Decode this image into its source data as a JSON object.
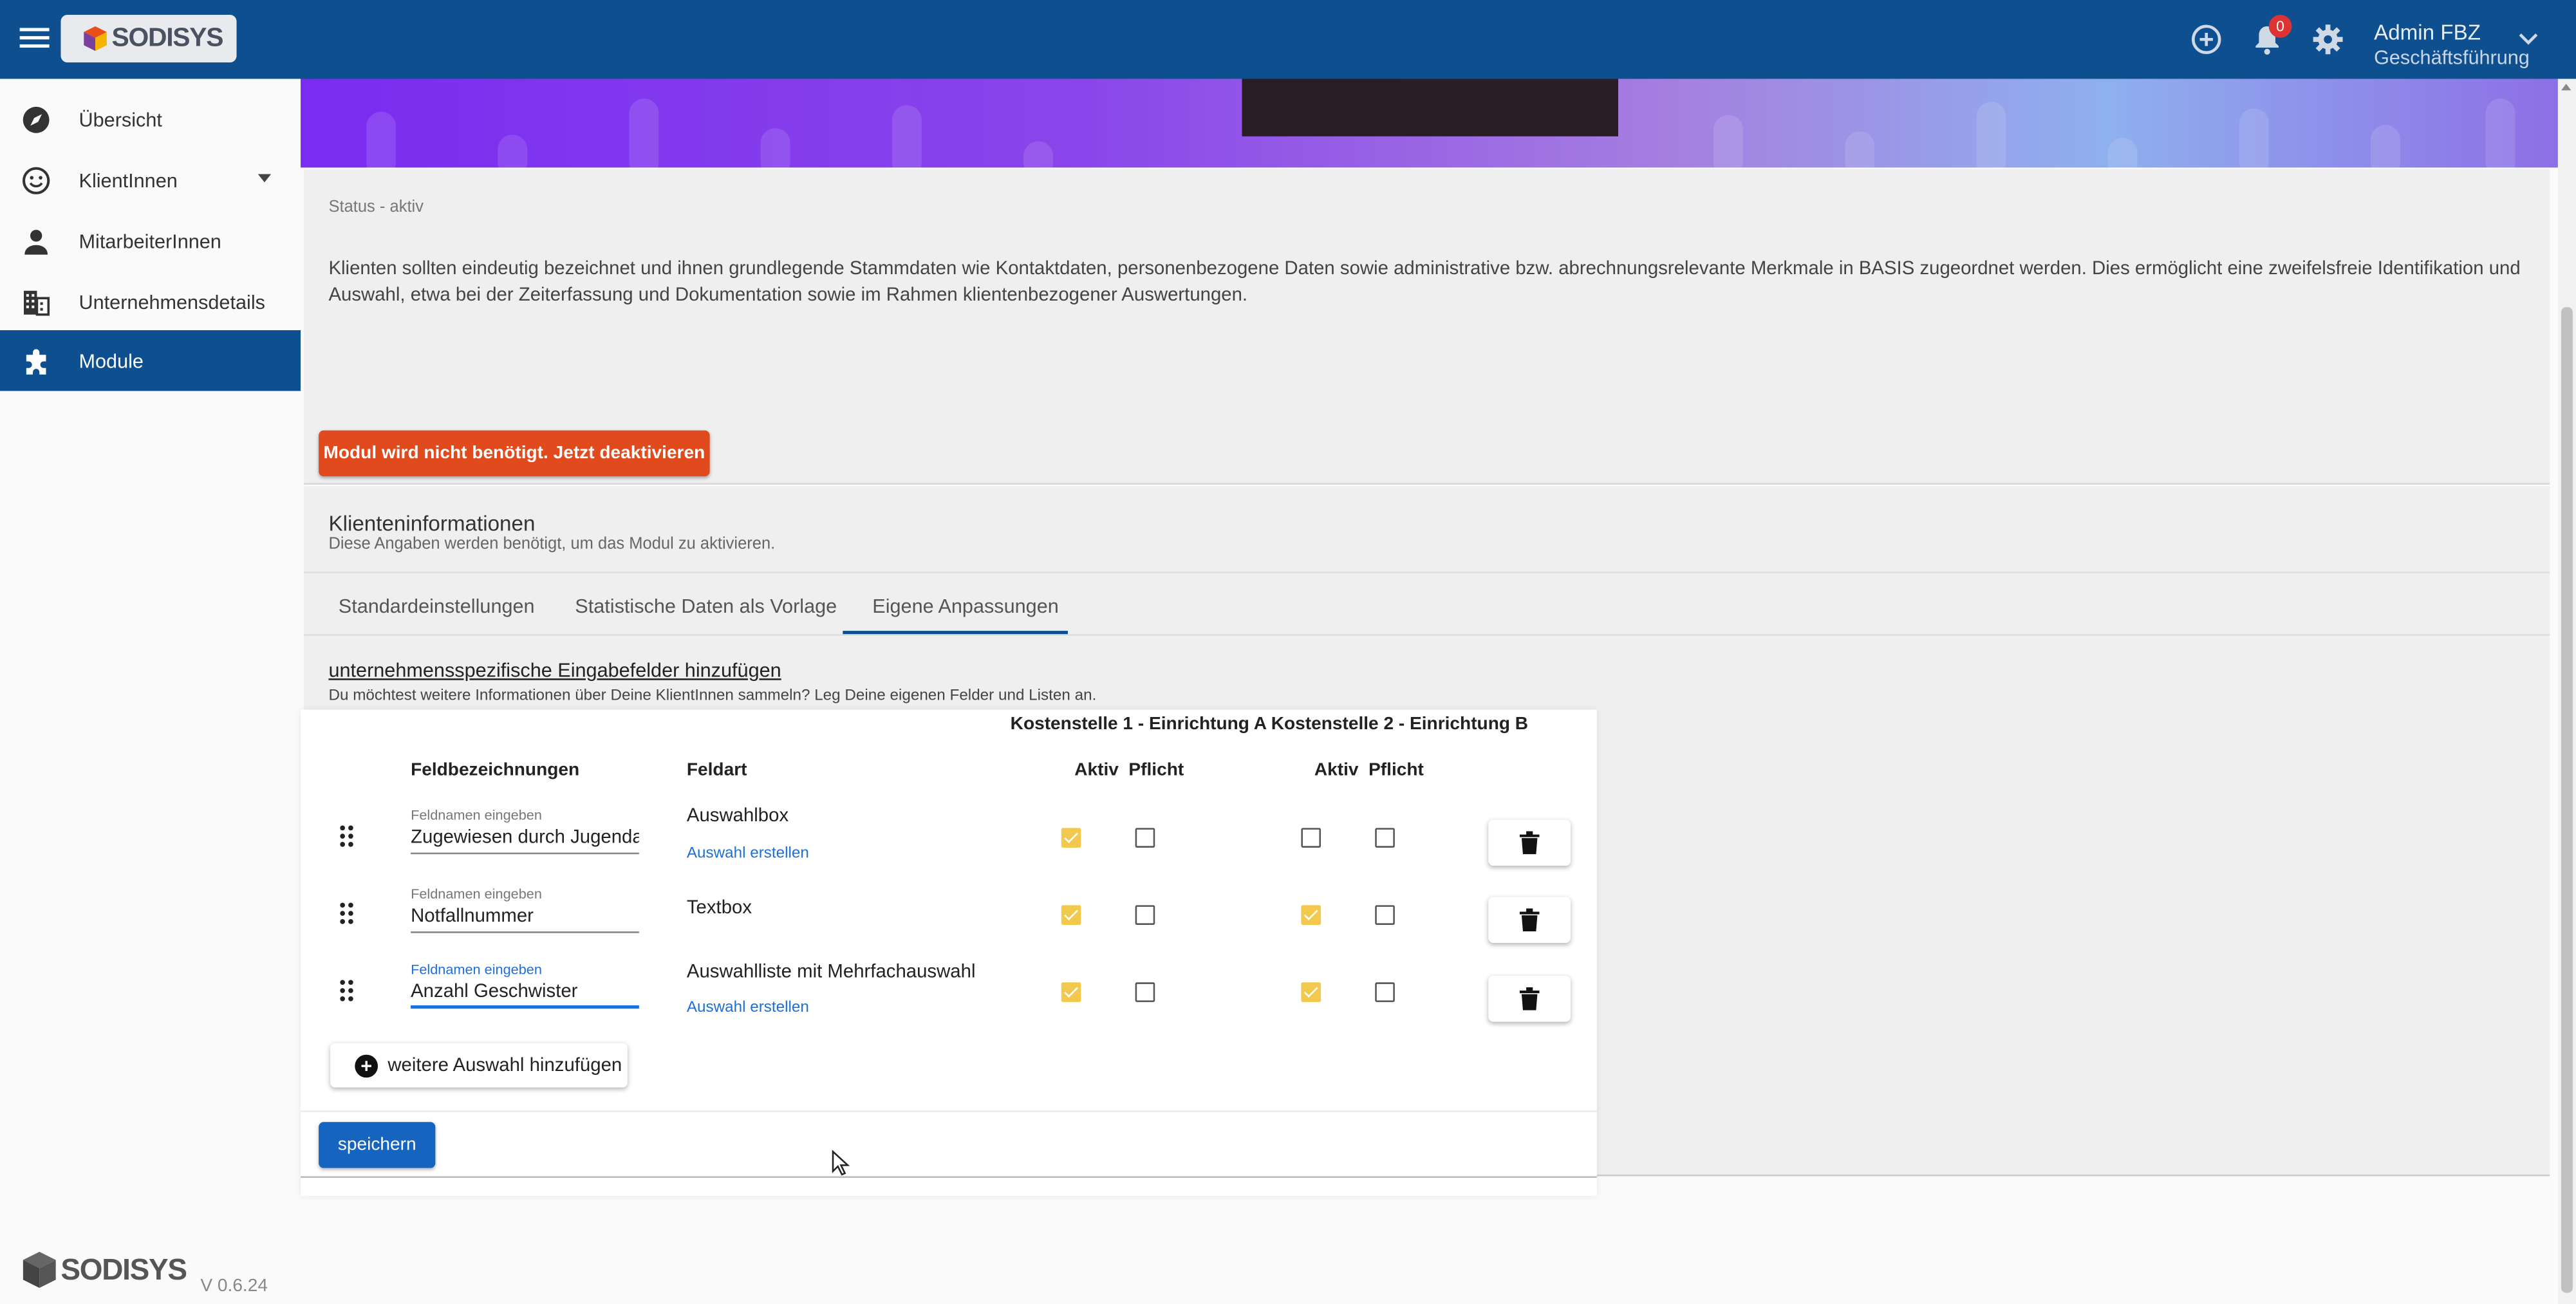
{
  "header": {
    "logo_text": "SODISYS",
    "notification_count": "0",
    "user_name": "Admin FBZ",
    "user_role": "Geschäftsführung",
    "icons": [
      "menu-icon",
      "add-circle-icon",
      "bell-icon",
      "gear-icon",
      "chevron-down-icon"
    ],
    "bar_color": "#0d4f8f"
  },
  "sidebar": {
    "items": [
      {
        "label": "Übersicht",
        "icon": "compass-icon",
        "active": false
      },
      {
        "label": "KlientInnen",
        "icon": "smiley-icon",
        "active": false,
        "expandable": true
      },
      {
        "label": "MitarbeiterInnen",
        "icon": "person-icon",
        "active": false
      },
      {
        "label": "Unternehmensdetails",
        "icon": "building-icon",
        "active": false
      },
      {
        "label": "Module",
        "icon": "puzzle-icon",
        "active": true
      }
    ],
    "footer_logo": "SODISYS",
    "version": "V 0.6.24"
  },
  "module": {
    "status": "Status - aktiv",
    "description": "Klienten sollten eindeutig bezeichnet und ihnen grundlegende Stammdaten wie Kontaktdaten, personenbezogene Daten sowie administrative bzw. abrechnungsrelevante Merkmale in BASIS zugeordnet werden. Dies ermöglicht eine zweifelsfreie Identifikation und Auswahl, etwa bei der Zeiterfassung und Dokumentation sowie im Rahmen klientenbezogener Auswertungen.",
    "deactivate_label": "Modul wird nicht benötigt. Jetzt deaktivieren",
    "deactivate_color": "#e04a1c"
  },
  "info": {
    "title": "Klienteninformationen",
    "subtitle": "Diese Angaben werden benötigt, um das Modul zu aktivieren.",
    "tabs": [
      {
        "label": "Standardeinstellungen",
        "active": false
      },
      {
        "label": "Statistische Daten als Vorlage",
        "active": false
      },
      {
        "label": "Eigene Anpassungen",
        "active": true
      }
    ],
    "custom_link": "unternehmensspezifische Eingabefelder hinzufügen",
    "custom_sub": "Du möchtest weitere Informationen über Deine KlientInnen sammeln? Leg Deine eigenen Felder und Listen an."
  },
  "dialog": {
    "cost_header": "Kostenstelle 1 - Einrichtung A Kostenstelle 2 - Einrichtung B",
    "columns": {
      "name": "Feldbezeichnungen",
      "type": "Feldart",
      "aktiv1": "Aktiv",
      "pflicht1": "Pflicht",
      "aktiv2": "Aktiv",
      "pflicht2": "Pflicht"
    },
    "rows": [
      {
        "label": "Feldnamen eingeben",
        "value": "Zugewiesen durch Jugendamt",
        "type": "Auswahlbox",
        "link": "Auswahl erstellen",
        "k1_aktiv": true,
        "k1_pflicht": false,
        "k2_aktiv": false,
        "k2_pflicht": false,
        "focused": false
      },
      {
        "label": "Feldnamen eingeben",
        "value": "Notfallnummer",
        "type": "Textbox",
        "link": "",
        "k1_aktiv": true,
        "k1_pflicht": false,
        "k2_aktiv": true,
        "k2_pflicht": false,
        "focused": false
      },
      {
        "label": "Feldnamen eingeben",
        "value": "Anzahl Geschwister",
        "type": "Auswahlliste mit Mehrfachauswahl",
        "link": "Auswahl erstellen",
        "k1_aktiv": true,
        "k1_pflicht": false,
        "k2_aktiv": true,
        "k2_pflicht": false,
        "focused": true
      }
    ],
    "add_label": "weitere Auswahl hinzufügen",
    "save_label": "speichern",
    "checkbox_on_color": "#f2c94c",
    "save_color": "#1565c0"
  }
}
